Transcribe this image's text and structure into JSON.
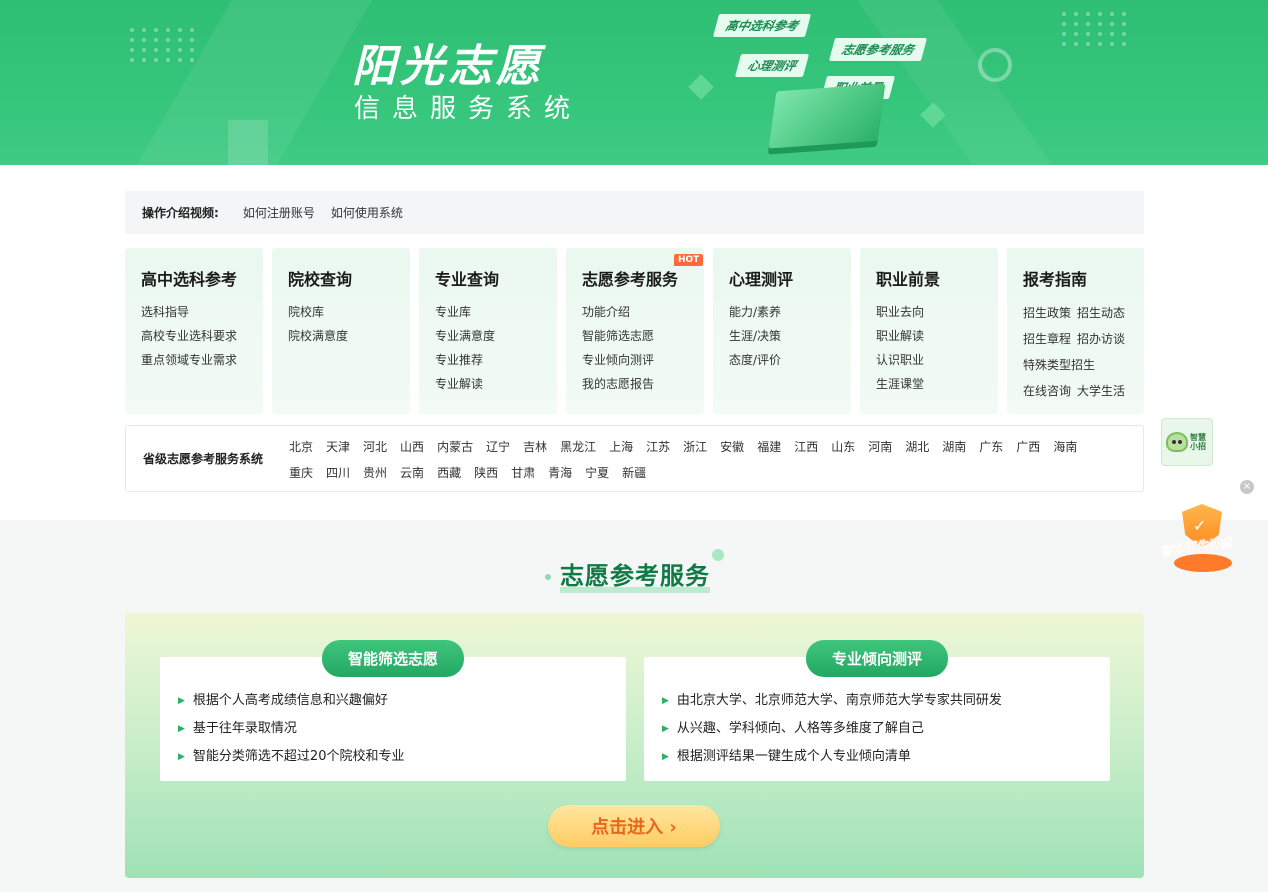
{
  "banner": {
    "title": "阳光志愿",
    "subtitle": "信息服务系统",
    "tags": [
      "高中选科参考",
      "志愿参考服务",
      "心理测评",
      "职业前景"
    ]
  },
  "intro": {
    "label": "操作介绍视频:",
    "links": [
      "如何注册账号",
      "如何使用系统"
    ]
  },
  "cards": [
    {
      "title": "高中选科参考",
      "items": [
        "选科指导",
        "高校专业选科要求",
        "重点领域专业需求"
      ]
    },
    {
      "title": "院校查询",
      "items": [
        "院校库",
        "院校满意度"
      ]
    },
    {
      "title": "专业查询",
      "items": [
        "专业库",
        "专业满意度",
        "专业推荐",
        "专业解读"
      ]
    },
    {
      "title": "志愿参考服务",
      "badge": "HOT",
      "items": [
        "功能介绍",
        "智能筛选志愿",
        "专业倾向测评",
        "我的志愿报告"
      ]
    },
    {
      "title": "心理测评",
      "items": [
        "能力/素养",
        "生涯/决策",
        "态度/评价"
      ]
    },
    {
      "title": "职业前景",
      "items": [
        "职业去向",
        "职业解读",
        "认识职业",
        "生涯课堂"
      ]
    },
    {
      "title": "报考指南",
      "pairs": [
        [
          "招生政策",
          "招生动态"
        ],
        [
          "招生章程",
          "招办访谈"
        ],
        [
          "特殊类型招生"
        ],
        [
          "在线咨询",
          "大学生活"
        ]
      ]
    }
  ],
  "provinces": {
    "label": "省级志愿参考服务系统",
    "list": [
      "北京",
      "天津",
      "河北",
      "山西",
      "内蒙古",
      "辽宁",
      "吉林",
      "黑龙江",
      "上海",
      "江苏",
      "浙江",
      "安徽",
      "福建",
      "江西",
      "山东",
      "河南",
      "湖北",
      "湖南",
      "广东",
      "广西",
      "海南",
      "重庆",
      "四川",
      "贵州",
      "云南",
      "西藏",
      "陕西",
      "甘肃",
      "青海",
      "宁夏",
      "新疆"
    ]
  },
  "service": {
    "title": "志愿参考服务",
    "left": {
      "title": "智能筛选志愿",
      "bullets": [
        "根据个人高考成绩信息和兴趣偏好",
        "基于往年录取情况",
        "智能分类筛选不超过20个院校和专业"
      ]
    },
    "right": {
      "title": "专业倾向测评",
      "bullets": [
        "由北京大学、北京师范大学、南京师范大学专家共同研发",
        "从兴趣、学科倾向、人格等多维度了解自己",
        "根据测评结果一键生成个人专业倾向清单"
      ]
    },
    "enter": "点击进入 ›"
  },
  "floating": {
    "ai_label": "智慧小招",
    "fraud_label": "警惕招生诈骗",
    "close": "×"
  },
  "colors": {
    "brand_green": "#2fbf74",
    "title_green": "#0f7a45",
    "hot_orange": "#ff6a3d",
    "enter_text": "#e8671d"
  }
}
